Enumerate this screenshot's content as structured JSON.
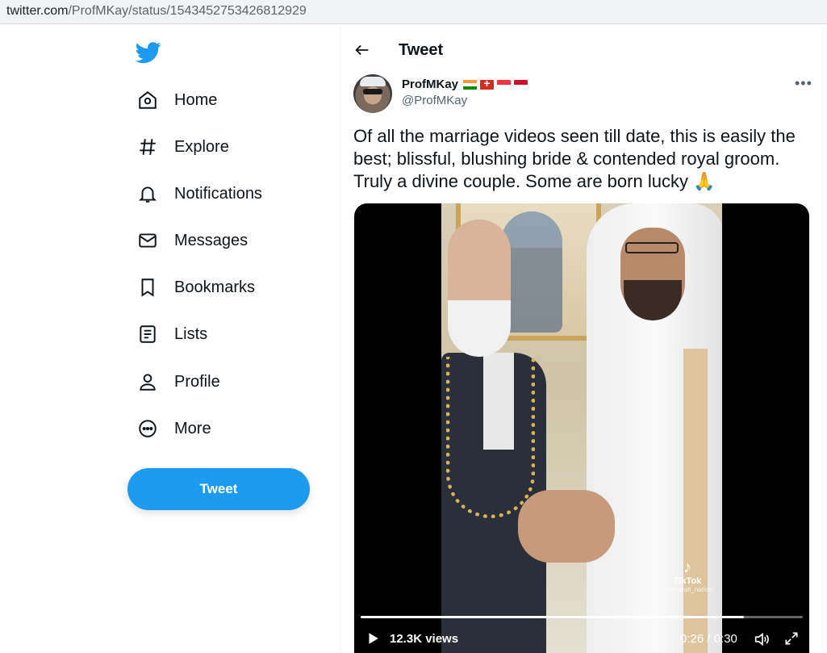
{
  "browser": {
    "domain": "twitter.com",
    "path": "/ProfMKay/status/1543452753426812929"
  },
  "sidebar": {
    "items": [
      {
        "label": "Home",
        "icon": "home-icon"
      },
      {
        "label": "Explore",
        "icon": "hashtag-icon"
      },
      {
        "label": "Notifications",
        "icon": "bell-icon"
      },
      {
        "label": "Messages",
        "icon": "envelope-icon"
      },
      {
        "label": "Bookmarks",
        "icon": "bookmark-icon"
      },
      {
        "label": "Lists",
        "icon": "list-icon"
      },
      {
        "label": "Profile",
        "icon": "person-icon"
      },
      {
        "label": "More",
        "icon": "more-circle-icon"
      }
    ],
    "tweet_button": "Tweet"
  },
  "header": {
    "title": "Tweet"
  },
  "tweet": {
    "author": {
      "name": "ProfMKay",
      "handle": "@ProfMKay",
      "flags": [
        "india-flag",
        "switzerland-flag",
        "singapore-flag",
        "indonesia-flag"
      ]
    },
    "text": "Of all the marriage videos seen till date, this is easily the best; blissful, blushing bride & contended royal groom. Truly a divine couple. Some are born lucky 🙏",
    "video": {
      "watermark": "TikTok",
      "watermark_user": "@emarati_nation",
      "views": "12.3K views",
      "time": "0:26 / 0:30",
      "progress": 0.867
    }
  },
  "colors": {
    "accent": "#1d9bf0",
    "text": "#0f1419",
    "muted": "#536471"
  }
}
